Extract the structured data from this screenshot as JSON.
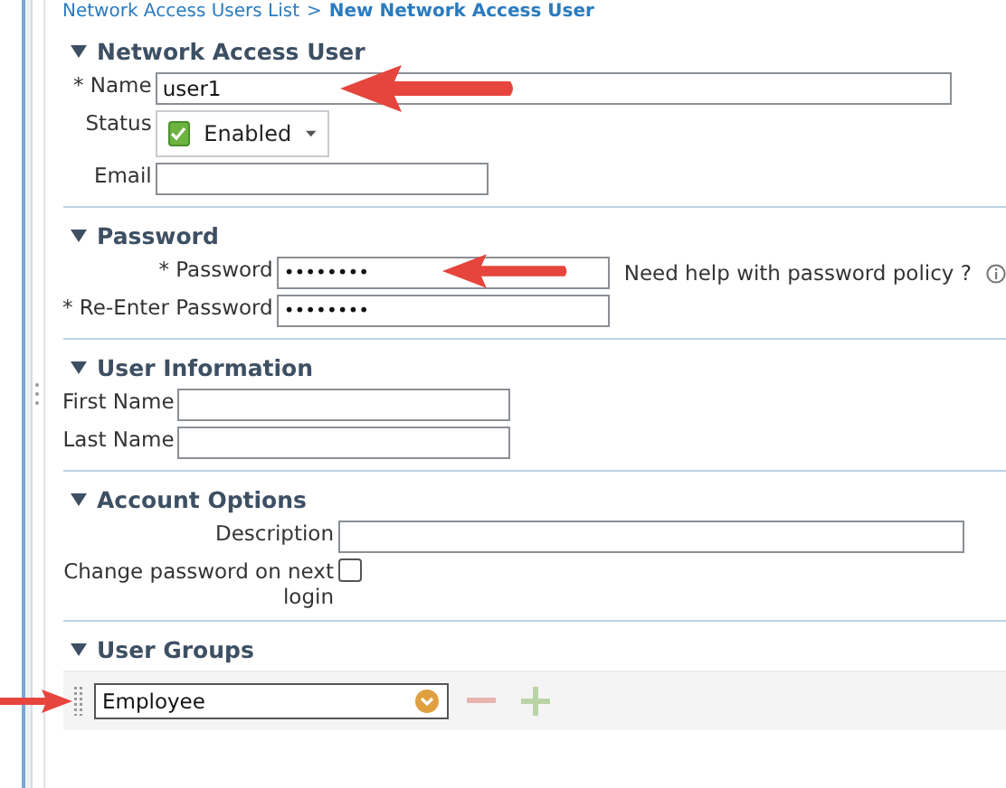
{
  "breadcrumb": {
    "parent": "Network Access Users List",
    "separator": ">",
    "current": "New Network Access User"
  },
  "sections": [
    {
      "title": "Network Access User",
      "expanded": true,
      "fields": [
        {
          "kind": "text",
          "label": "* Name",
          "value": "user1",
          "annotated": true
        },
        {
          "kind": "status",
          "label": "Status",
          "value": "Enabled",
          "checked": true
        },
        {
          "kind": "text",
          "label": "Email"
        }
      ]
    },
    {
      "title": "Password",
      "expanded": true,
      "fields": [
        {
          "kind": "password",
          "label": "* Password",
          "value": "••••••••",
          "annotated": true,
          "help": "Need help with password policy ?"
        },
        {
          "kind": "password",
          "label": "* Re-Enter Password",
          "value": "••••••••"
        }
      ]
    },
    {
      "title": "User Information",
      "expanded": true,
      "fields": [
        {
          "kind": "text",
          "label": "First Name"
        },
        {
          "kind": "text",
          "label": "Last Name"
        }
      ]
    },
    {
      "title": "Account Options",
      "expanded": true,
      "fields": [
        {
          "kind": "text",
          "label": "Description"
        },
        {
          "kind": "checkbox",
          "label": "Change password on next login",
          "checked": false
        }
      ]
    },
    {
      "title": "User Groups",
      "expanded": true,
      "groups": [
        {
          "value": "Employee",
          "annotated": true
        }
      ]
    }
  ]
}
